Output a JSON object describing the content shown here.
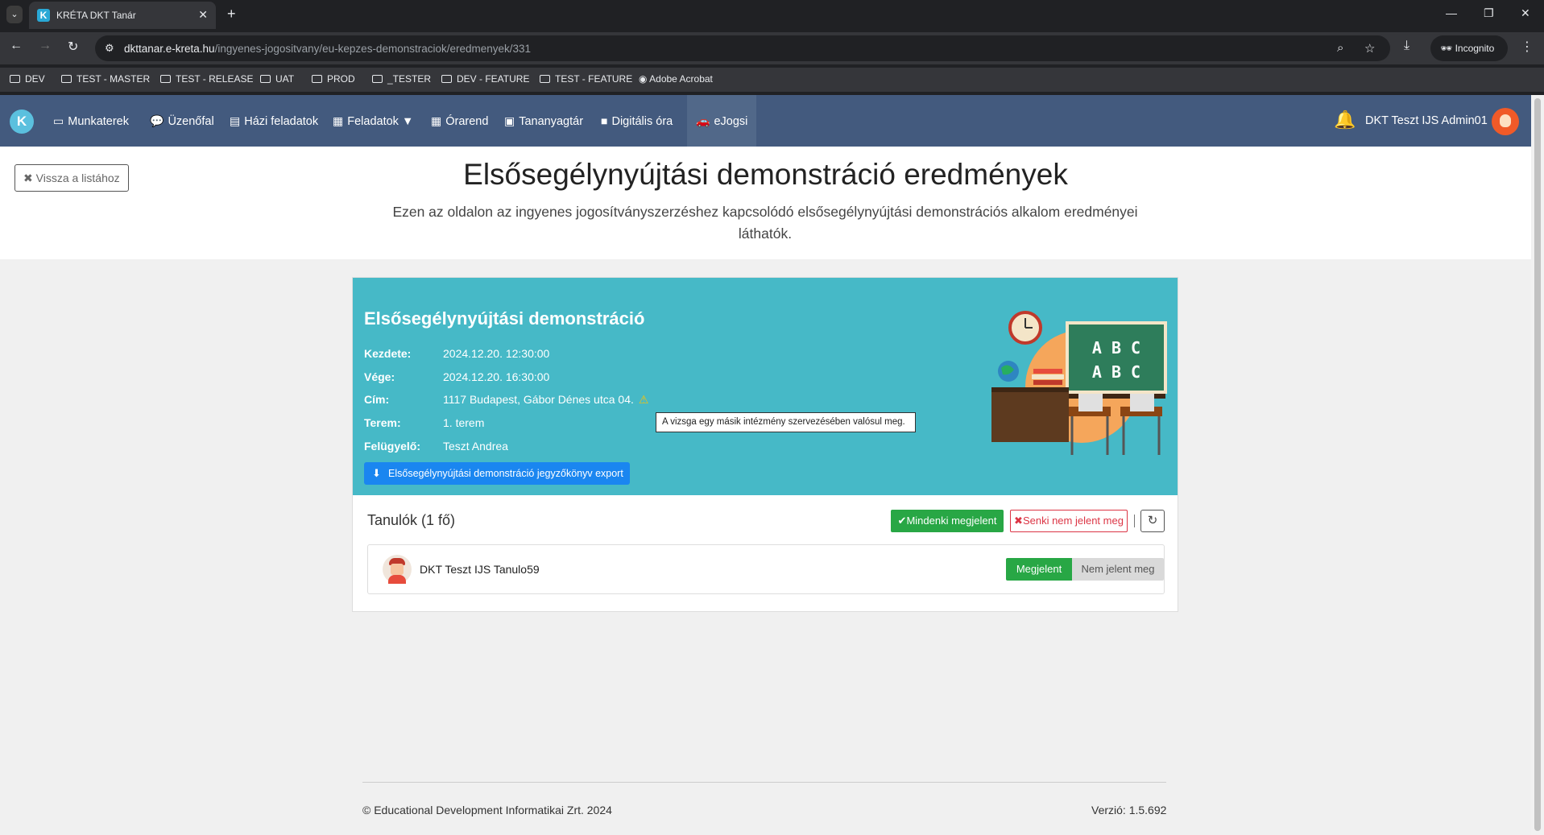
{
  "browser": {
    "tab_title": "KRÉTA DKT Tanár",
    "url_host": "dkttanar.e-kreta.hu",
    "url_path": "/ingyenes-jogositvany/eu-kepzes-demonstraciok/eredmenyek/331",
    "incognito_label": "Incognito",
    "bookmarks": [
      "DEV",
      "TEST - MASTER",
      "TEST - RELEASE",
      "UAT",
      "PROD",
      "_TESTER",
      "DEV - FEATURE",
      "TEST - FEATURE",
      "Adobe Acrobat"
    ]
  },
  "nav": {
    "items": [
      {
        "label": "Munkaterek",
        "icon": "laptop-icon"
      },
      {
        "label": "Üzenőfal",
        "icon": "comment-icon"
      },
      {
        "label": "Házi feladatok",
        "icon": "file-icon"
      },
      {
        "label": "Feladatok",
        "icon": "clipboard-icon"
      },
      {
        "label": "Órarend",
        "icon": "calendar-icon"
      },
      {
        "label": "Tananyagtár",
        "icon": "book-icon"
      },
      {
        "label": "Digitális óra",
        "icon": "video-icon"
      },
      {
        "label": "eJogsi",
        "icon": "car-icon"
      }
    ],
    "user_name": "DKT Teszt IJS Admin01"
  },
  "header": {
    "back_label": "Vissza a listához",
    "title": "Elsősegélynyújtási demonstráció eredmények",
    "subtitle": "Ezen az oldalon az ingyenes jogosítványszerzéshez kapcsolódó elsősegélynyújtási demonstrációs alkalom eredményei láthatók."
  },
  "card": {
    "title": "Elsősegélynyújtási demonstráció",
    "fields": [
      {
        "label": "Kezdete:",
        "value": "2024.12.20. 12:30:00"
      },
      {
        "label": "Vége:",
        "value": "2024.12.20. 16:30:00"
      },
      {
        "label": "Cím:",
        "value": "1117 Budapest, Gábor Dénes utca 04."
      },
      {
        "label": "Terem:",
        "value": "1. terem"
      },
      {
        "label": "Felügyelő:",
        "value": "Teszt Andrea"
      }
    ],
    "export_label": "Elsősegélynyújtási demonstráció jegyzőkönyv export",
    "tooltip": "A vizsga egy másik intézmény szervezésében valósul meg.",
    "illustration_letters": [
      "A B C",
      "A B C"
    ]
  },
  "students": {
    "title": "Tanulók (1 fő)",
    "all_present_label": "Mindenki megjelent",
    "none_present_label": "Senki nem jelent meg",
    "rows": [
      {
        "name": "DKT Teszt IJS Tanulo59",
        "present_label": "Megjelent",
        "absent_label": "Nem jelent meg"
      }
    ]
  },
  "footer": {
    "copyright": "© Educational Development Informatikai Zrt. 2024",
    "version": "Verzió: 1.5.692"
  },
  "colors": {
    "navbar": "#435a7e",
    "card_header": "#46b9c7",
    "export_button": "#1a86f0",
    "success": "#28a745",
    "danger": "#dc3545"
  }
}
